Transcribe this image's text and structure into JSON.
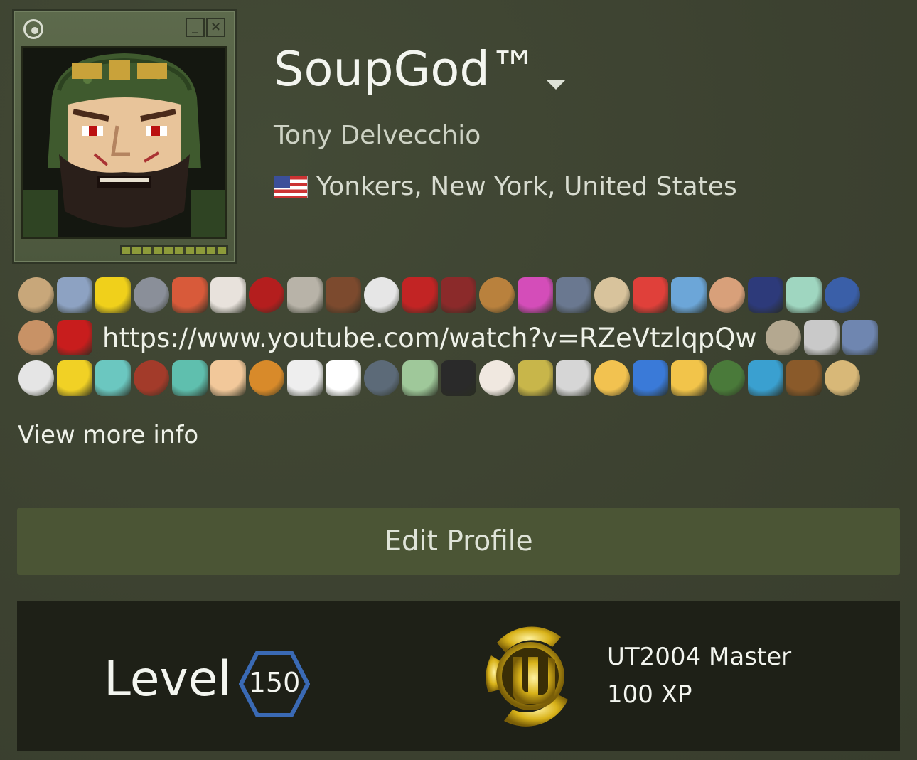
{
  "profile": {
    "persona_name": "SoupGod™",
    "real_name": "Tony Delvecchio",
    "location": "Yonkers, New York, United States",
    "flag_icon": "us-flag-icon",
    "summary_link": "https://www.youtube.com/watch?v=RZeVtzlqpQw",
    "view_more": "View more info",
    "edit_profile": "Edit Profile"
  },
  "level": {
    "label": "Level",
    "value": "150",
    "hex_color": "#3a6ab5"
  },
  "badge": {
    "name": "UT2004 Master",
    "xp": "100 XP",
    "icon": "unreal-tournament-badge-icon"
  },
  "emoticons": {
    "row1": [
      "#c8a77a",
      "#8da2c2",
      "#f0d01b",
      "#8a8f99",
      "#d85a3a",
      "#e8e2dc",
      "#b41e1e",
      "#b8b3a8",
      "#7c4a2e",
      "#e6e6e6",
      "#c22424",
      "#8b2a2a",
      "#b9813d",
      "#d44db9",
      "#6a7890",
      "#d8c39c",
      "#e0403a",
      "#6ca6d8",
      "#d8a07a",
      "#2d3a7a",
      "#9fd6c0",
      "#3a5fa8"
    ],
    "row2_left": [
      "#c89266",
      "#c81d1d"
    ],
    "row2_right": [
      "#b4a890",
      "#c9c9c9",
      "#6f86b0"
    ],
    "row3": [
      "#e5e5e5",
      "#f1d125",
      "#6bc7c0",
      "#a33b2a",
      "#5fbfae",
      "#f2c89a",
      "#d88a2a",
      "#eeeeee",
      "#ffffff",
      "#5c6a78",
      "#9fc89a",
      "#2a2a2a",
      "#f0e8e0",
      "#c8b64a",
      "#d6d6d6",
      "#f2c250",
      "#3a7ad8",
      "#f2c44a",
      "#4a7a3a",
      "#3aa0d0",
      "#8a5a2a",
      "#d8b878"
    ]
  }
}
